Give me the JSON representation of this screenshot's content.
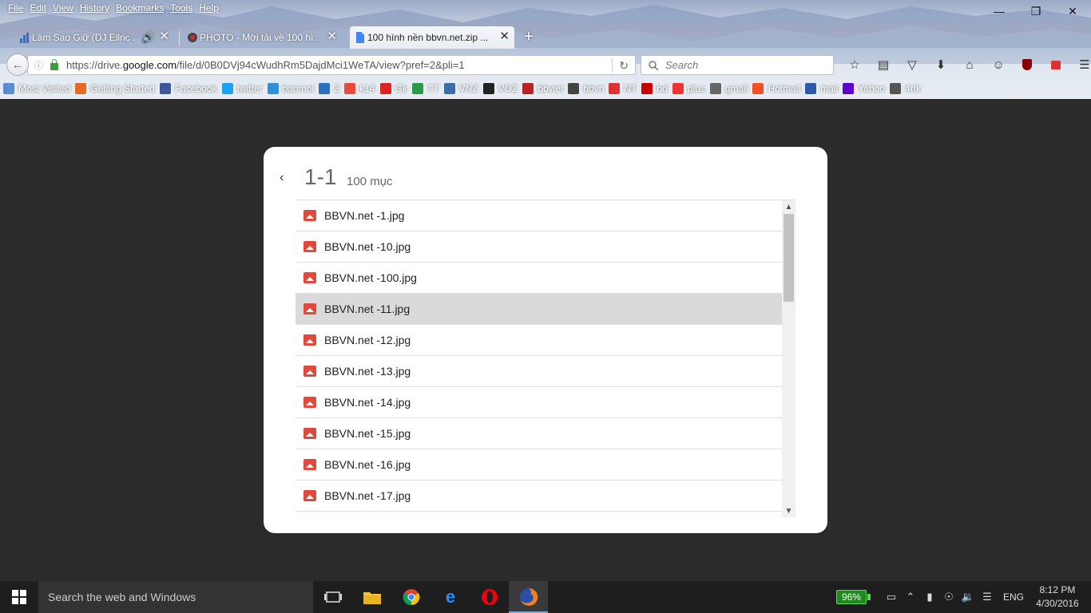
{
  "menu": [
    "File",
    "Edit",
    "View",
    "History",
    "Bookmarks",
    "Tools",
    "Help"
  ],
  "tabs": [
    {
      "title": "Làm Sao Giữ (DJ Ellric ...",
      "icon": "audio-bars-icon",
      "audio": true
    },
    {
      "title": "PHOTO - Mời tải về 100 hì...",
      "icon": "bbvn-icon"
    },
    {
      "title": "100 hình nền bbvn.net.zip ...",
      "icon": "google-drive-file-icon",
      "active": true
    }
  ],
  "url": {
    "prefix": "https://drive.",
    "domain": "google.com",
    "path": "/file/d/0B0DVj94cWudhRm5DajdMci1WeTA/view?pref=2&pli=1"
  },
  "search": {
    "placeholder": "Search"
  },
  "bookmarks": [
    {
      "label": "Most Visited",
      "color": "#5b8dd6"
    },
    {
      "label": "Getting Started",
      "color": "#e66a1f"
    },
    {
      "label": "Facebook",
      "color": "#3b5998"
    },
    {
      "label": "twitter",
      "color": "#1da1f2"
    },
    {
      "label": "baomoi",
      "color": "#2f8fd8"
    },
    {
      "label": "Z",
      "color": "#2b6fbf"
    },
    {
      "label": "k14",
      "color": "#e64b3c"
    },
    {
      "label": "Gk",
      "color": "#d22"
    },
    {
      "label": "TT",
      "color": "#2a9a4a"
    },
    {
      "label": "VNZ",
      "color": "#3a6ea8"
    },
    {
      "label": "VOZ",
      "color": "#222"
    },
    {
      "label": "bbviet",
      "color": "#b22"
    },
    {
      "label": "bbvn",
      "color": "#444"
    },
    {
      "label": "NT",
      "color": "#d33"
    },
    {
      "label": "bd",
      "color": "#c00"
    },
    {
      "label": "plus",
      "color": "#e33"
    },
    {
      "label": "gmail",
      "color": "#666"
    },
    {
      "label": "Hotmail",
      "color": "#f25022"
    },
    {
      "label": "mail",
      "color": "#2d5aa8"
    },
    {
      "label": "Yahoo",
      "color": "#5f01d1"
    },
    {
      "label": "4rtk",
      "color": "#555"
    }
  ],
  "panel": {
    "range": "1-1",
    "count": "100 mục",
    "files": [
      "BBVN.net -1.jpg",
      "BBVN.net -10.jpg",
      "BBVN.net -100.jpg",
      "BBVN.net -11.jpg",
      "BBVN.net -12.jpg",
      "BBVN.net -13.jpg",
      "BBVN.net -14.jpg",
      "BBVN.net -15.jpg",
      "BBVN.net -16.jpg",
      "BBVN.net -17.jpg"
    ],
    "highlighted_index": 3
  },
  "taskbar": {
    "search_placeholder": "Search the web and Windows",
    "battery": "96%",
    "language": "ENG",
    "time": "8:12 PM",
    "date": "4/30/2016"
  }
}
